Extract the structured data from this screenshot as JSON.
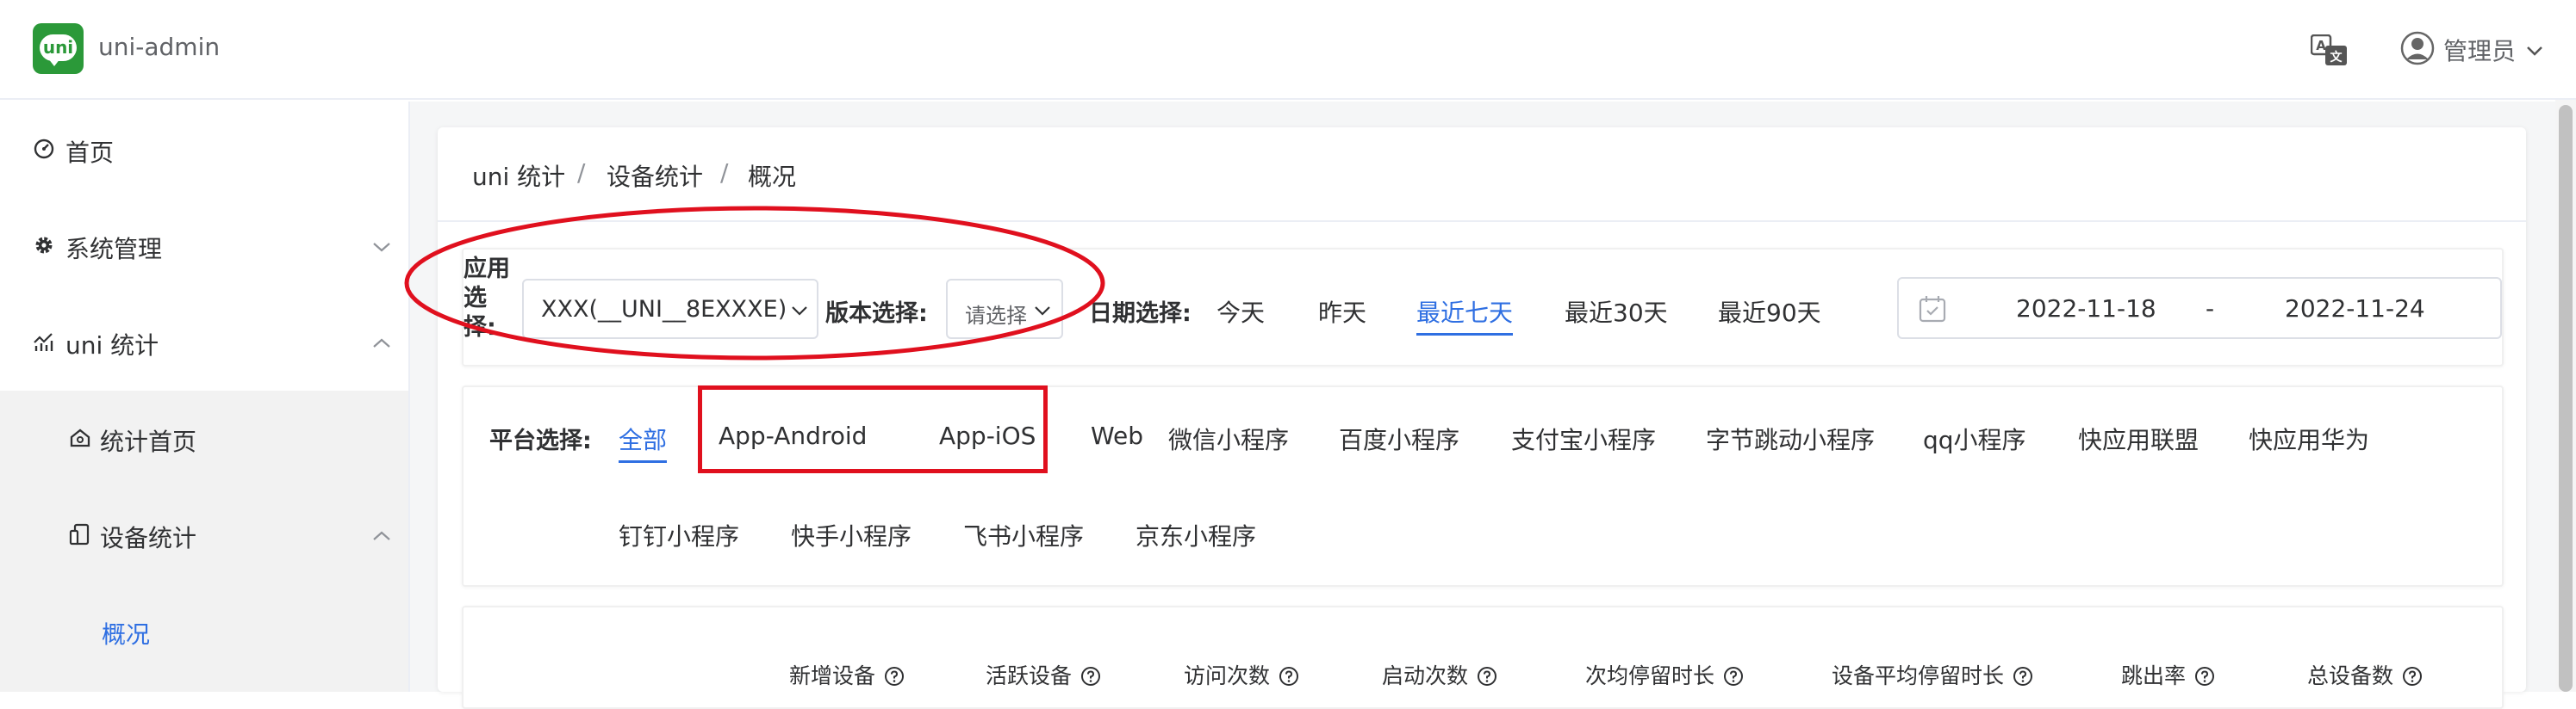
{
  "header": {
    "logo_text": "uni",
    "app_title": "uni-admin",
    "user_name": "管理员",
    "icons": [
      "translate-icon",
      "user-avatar-icon",
      "chevron-down-icon"
    ]
  },
  "sidebar": {
    "items": [
      {
        "label": "首页",
        "icon": "dashboard-icon"
      },
      {
        "label": "系统管理",
        "icon": "gear-icon"
      },
      {
        "label": "uni 统计",
        "icon": "stats-icon"
      },
      {
        "label": "统计首页",
        "icon": "home-icon"
      },
      {
        "label": "设备统计",
        "icon": "device-icon"
      },
      {
        "label": "概况",
        "active": true
      }
    ]
  },
  "breadcrumb": [
    "uni 统计",
    "设备统计",
    "概况"
  ],
  "breadcrumb_separator": "/",
  "filters": {
    "app_label": "应用选择:",
    "app_value": "XXX(__UNI__8EXXXE)",
    "version_label": "版本选择:",
    "version_placeholder": "请选择",
    "date_label": "日期选择:",
    "date_options": [
      "今天",
      "昨天",
      "最近七天",
      "最近30天",
      "最近90天"
    ],
    "date_selected": "最近七天",
    "date_start": "2022-11-18",
    "date_separator": "-",
    "date_end": "2022-11-24"
  },
  "platform": {
    "label": "平台选择:",
    "options": [
      "全部",
      "App-Android",
      "App-iOS",
      "Web",
      "微信小程序",
      "百度小程序",
      "支付宝小程序",
      "字节跳动小程序",
      "qq小程序",
      "快应用联盟",
      "快应用华为",
      "钉钉小程序",
      "快手小程序",
      "飞书小程序",
      "京东小程序"
    ],
    "selected": "全部"
  },
  "metrics": [
    "新增设备",
    "活跃设备",
    "访问次数",
    "启动次数",
    "次均停留时长",
    "设备平均停留时长",
    "跳出率",
    "总设备数"
  ],
  "colors": {
    "accent": "#2f6fe2",
    "logo": "#2b9939",
    "annotation": "#e0101e",
    "submenu_bg": "#f2f2f2"
  }
}
